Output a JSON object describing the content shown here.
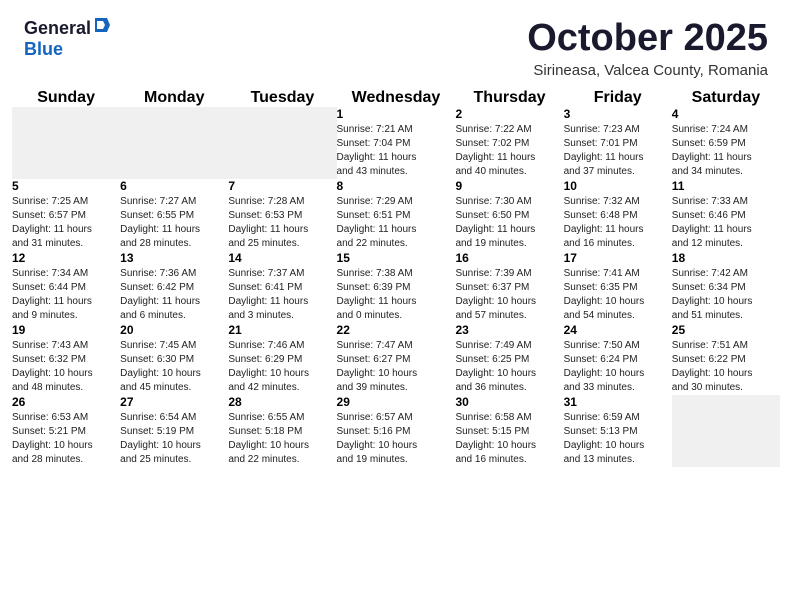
{
  "header": {
    "logo_general": "General",
    "logo_blue": "Blue",
    "month_title": "October 2025",
    "subtitle": "Sirineasa, Valcea County, Romania"
  },
  "days_of_week": [
    "Sunday",
    "Monday",
    "Tuesday",
    "Wednesday",
    "Thursday",
    "Friday",
    "Saturday"
  ],
  "weeks": [
    [
      {
        "day": "",
        "info": ""
      },
      {
        "day": "",
        "info": ""
      },
      {
        "day": "",
        "info": ""
      },
      {
        "day": "1",
        "info": "Sunrise: 7:21 AM\nSunset: 7:04 PM\nDaylight: 11 hours\nand 43 minutes."
      },
      {
        "day": "2",
        "info": "Sunrise: 7:22 AM\nSunset: 7:02 PM\nDaylight: 11 hours\nand 40 minutes."
      },
      {
        "day": "3",
        "info": "Sunrise: 7:23 AM\nSunset: 7:01 PM\nDaylight: 11 hours\nand 37 minutes."
      },
      {
        "day": "4",
        "info": "Sunrise: 7:24 AM\nSunset: 6:59 PM\nDaylight: 11 hours\nand 34 minutes."
      }
    ],
    [
      {
        "day": "5",
        "info": "Sunrise: 7:25 AM\nSunset: 6:57 PM\nDaylight: 11 hours\nand 31 minutes."
      },
      {
        "day": "6",
        "info": "Sunrise: 7:27 AM\nSunset: 6:55 PM\nDaylight: 11 hours\nand 28 minutes."
      },
      {
        "day": "7",
        "info": "Sunrise: 7:28 AM\nSunset: 6:53 PM\nDaylight: 11 hours\nand 25 minutes."
      },
      {
        "day": "8",
        "info": "Sunrise: 7:29 AM\nSunset: 6:51 PM\nDaylight: 11 hours\nand 22 minutes."
      },
      {
        "day": "9",
        "info": "Sunrise: 7:30 AM\nSunset: 6:50 PM\nDaylight: 11 hours\nand 19 minutes."
      },
      {
        "day": "10",
        "info": "Sunrise: 7:32 AM\nSunset: 6:48 PM\nDaylight: 11 hours\nand 16 minutes."
      },
      {
        "day": "11",
        "info": "Sunrise: 7:33 AM\nSunset: 6:46 PM\nDaylight: 11 hours\nand 12 minutes."
      }
    ],
    [
      {
        "day": "12",
        "info": "Sunrise: 7:34 AM\nSunset: 6:44 PM\nDaylight: 11 hours\nand 9 minutes."
      },
      {
        "day": "13",
        "info": "Sunrise: 7:36 AM\nSunset: 6:42 PM\nDaylight: 11 hours\nand 6 minutes."
      },
      {
        "day": "14",
        "info": "Sunrise: 7:37 AM\nSunset: 6:41 PM\nDaylight: 11 hours\nand 3 minutes."
      },
      {
        "day": "15",
        "info": "Sunrise: 7:38 AM\nSunset: 6:39 PM\nDaylight: 11 hours\nand 0 minutes."
      },
      {
        "day": "16",
        "info": "Sunrise: 7:39 AM\nSunset: 6:37 PM\nDaylight: 10 hours\nand 57 minutes."
      },
      {
        "day": "17",
        "info": "Sunrise: 7:41 AM\nSunset: 6:35 PM\nDaylight: 10 hours\nand 54 minutes."
      },
      {
        "day": "18",
        "info": "Sunrise: 7:42 AM\nSunset: 6:34 PM\nDaylight: 10 hours\nand 51 minutes."
      }
    ],
    [
      {
        "day": "19",
        "info": "Sunrise: 7:43 AM\nSunset: 6:32 PM\nDaylight: 10 hours\nand 48 minutes."
      },
      {
        "day": "20",
        "info": "Sunrise: 7:45 AM\nSunset: 6:30 PM\nDaylight: 10 hours\nand 45 minutes."
      },
      {
        "day": "21",
        "info": "Sunrise: 7:46 AM\nSunset: 6:29 PM\nDaylight: 10 hours\nand 42 minutes."
      },
      {
        "day": "22",
        "info": "Sunrise: 7:47 AM\nSunset: 6:27 PM\nDaylight: 10 hours\nand 39 minutes."
      },
      {
        "day": "23",
        "info": "Sunrise: 7:49 AM\nSunset: 6:25 PM\nDaylight: 10 hours\nand 36 minutes."
      },
      {
        "day": "24",
        "info": "Sunrise: 7:50 AM\nSunset: 6:24 PM\nDaylight: 10 hours\nand 33 minutes."
      },
      {
        "day": "25",
        "info": "Sunrise: 7:51 AM\nSunset: 6:22 PM\nDaylight: 10 hours\nand 30 minutes."
      }
    ],
    [
      {
        "day": "26",
        "info": "Sunrise: 6:53 AM\nSunset: 5:21 PM\nDaylight: 10 hours\nand 28 minutes."
      },
      {
        "day": "27",
        "info": "Sunrise: 6:54 AM\nSunset: 5:19 PM\nDaylight: 10 hours\nand 25 minutes."
      },
      {
        "day": "28",
        "info": "Sunrise: 6:55 AM\nSunset: 5:18 PM\nDaylight: 10 hours\nand 22 minutes."
      },
      {
        "day": "29",
        "info": "Sunrise: 6:57 AM\nSunset: 5:16 PM\nDaylight: 10 hours\nand 19 minutes."
      },
      {
        "day": "30",
        "info": "Sunrise: 6:58 AM\nSunset: 5:15 PM\nDaylight: 10 hours\nand 16 minutes."
      },
      {
        "day": "31",
        "info": "Sunrise: 6:59 AM\nSunset: 5:13 PM\nDaylight: 10 hours\nand 13 minutes."
      },
      {
        "day": "",
        "info": ""
      }
    ]
  ]
}
